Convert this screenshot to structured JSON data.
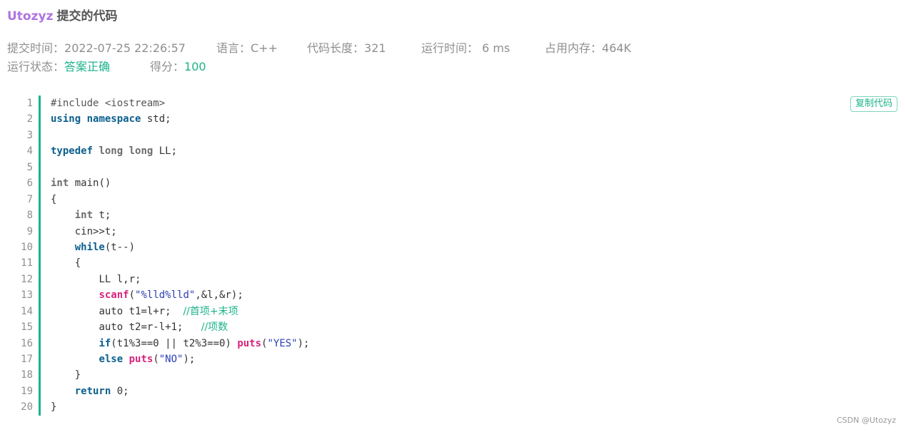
{
  "header": {
    "username": "Utozyz",
    "title_suffix": "提交的代码"
  },
  "meta": {
    "submit_time_label": "提交时间：",
    "submit_time": "2022-07-25 22:26:57",
    "language_label": "语言：",
    "language": "C++",
    "code_length_label": "代码长度：",
    "code_length": "321",
    "run_time_label": "运行时间：",
    "run_time": " 6 ms",
    "memory_label": "占用内存：",
    "memory": "464K",
    "status_label": "运行状态：",
    "status": "答案正确",
    "score_label": "得分：",
    "score": "100"
  },
  "code": {
    "copy_label": "复制代码",
    "line_numbers": [
      "1",
      "2",
      "3",
      "4",
      "5",
      "6",
      "7",
      "8",
      "9",
      "10",
      "11",
      "12",
      "13",
      "14",
      "15",
      "16",
      "17",
      "18",
      "19",
      "20"
    ],
    "t": {
      "l1": "#include <iostream>",
      "l2_kw1": "using",
      "l2_kw2": "namespace",
      "l2_rest": " std;",
      "l4_kw": "typedef",
      "l4_ty": "long long",
      "l4_rest": " LL;",
      "l6_ty": "int",
      "l6_rest": " main()",
      "l7": "{",
      "l8_ty": "int",
      "l8_rest": " t;",
      "l9": "cin>>t;",
      "l10_kw": "while",
      "l10_rest": "(t--)",
      "l11": "{",
      "l12": "LL l,r;",
      "l13_fn": "scanf",
      "l13_a": "(",
      "l13_str": "\"%lld%lld\"",
      "l13_b": ",&l,&r);",
      "l14_code": "auto t1=l+r;  ",
      "l14_cm": "//首项+末项",
      "l15_code": "auto t2=r-l+1;   ",
      "l15_cm": "//项数",
      "l16_kw": "if",
      "l16_mid": "(t1%3==0 || t2%3==0) ",
      "l16_fn": "puts",
      "l16_a": "(",
      "l16_str": "\"YES\"",
      "l16_b": ");",
      "l17_kw": "else",
      "l17_fn": "puts",
      "l17_a": "(",
      "l17_str": "\"NO\"",
      "l17_b": ");",
      "l18": "}",
      "l19_kw": "return",
      "l19_rest": " 0;",
      "l20": "}"
    }
  },
  "watermark": "CSDN @Utozyz"
}
